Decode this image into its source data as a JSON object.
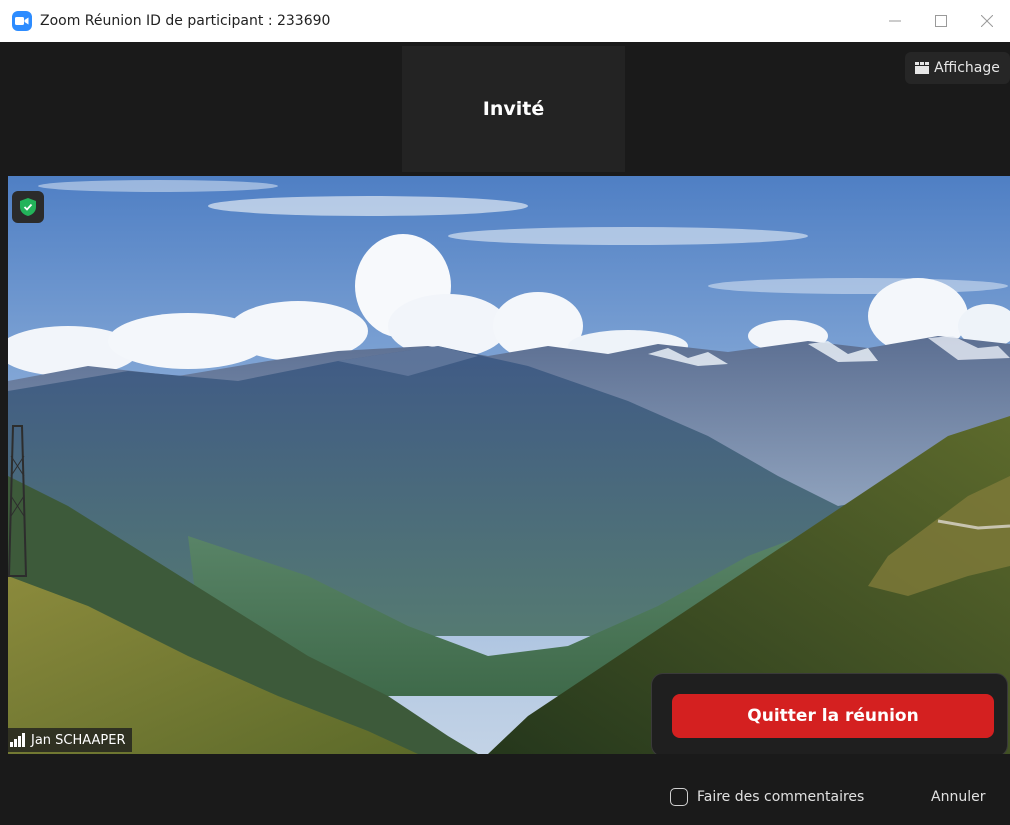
{
  "window": {
    "title": "Zoom Réunion ID de participant : 233690"
  },
  "top_strip": {
    "guest_name": "Invité",
    "view_label": "Affichage"
  },
  "video": {
    "participant_name": "Jan SCHAAPER"
  },
  "leave_popup": {
    "leave_label": "Quitter la réunion"
  },
  "bottom_bar": {
    "feedback_label": "Faire des commentaires",
    "cancel_label": "Annuler"
  },
  "colors": {
    "accent": "#2d8cff",
    "leave": "#d42020",
    "security": "#23b35a"
  },
  "icons": [
    "zoom-camera-icon",
    "minimize-icon",
    "maximize-icon",
    "close-icon",
    "grid-view-icon",
    "security-shield-icon",
    "signal-strength-icon"
  ]
}
